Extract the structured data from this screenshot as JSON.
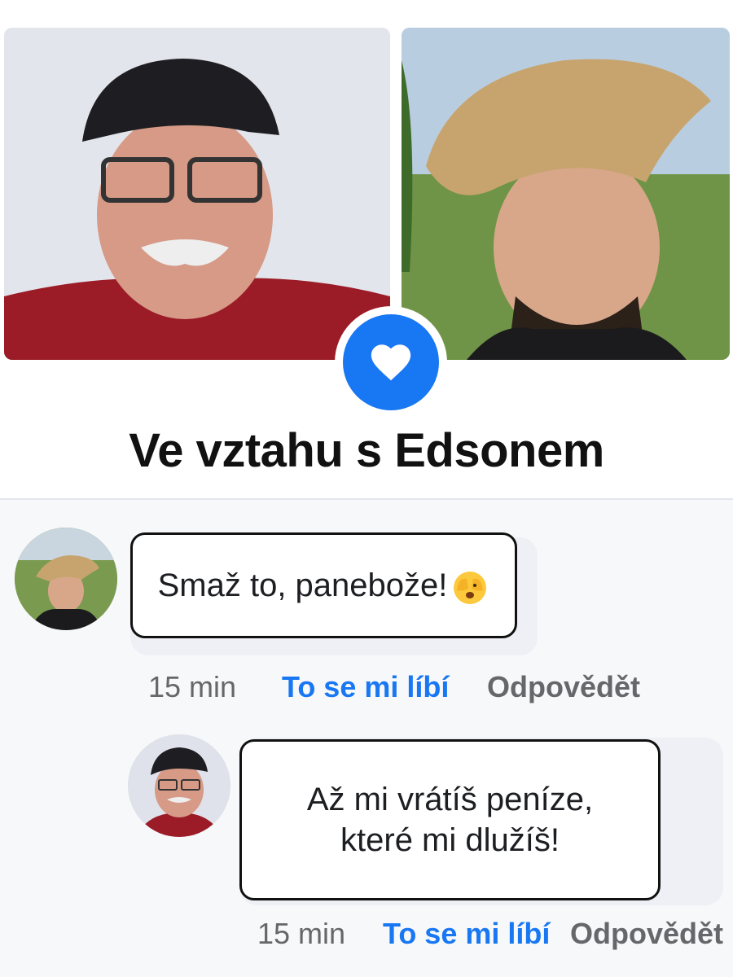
{
  "relationship": {
    "title": "Ve vztahu s Edsonem",
    "photos": [
      {
        "alt": "older man with glasses and black cap"
      },
      {
        "alt": "young man with straw cowboy hat"
      }
    ],
    "badge_icon": "heart-icon",
    "accent_color": "#1877f2"
  },
  "comments": [
    {
      "text": "Smaž to, panebože!",
      "emoji_icon": "face-with-hand-over-eyes-emoji",
      "time": "15 min",
      "like_label": "To se mi líbí",
      "reply_label": "Odpovědět"
    },
    {
      "text": "Až mi vrátíš peníze, které mi dlužíš!",
      "time": "15 min",
      "like_label": "To se mi líbí",
      "reply_label": "Odpovědět"
    }
  ]
}
